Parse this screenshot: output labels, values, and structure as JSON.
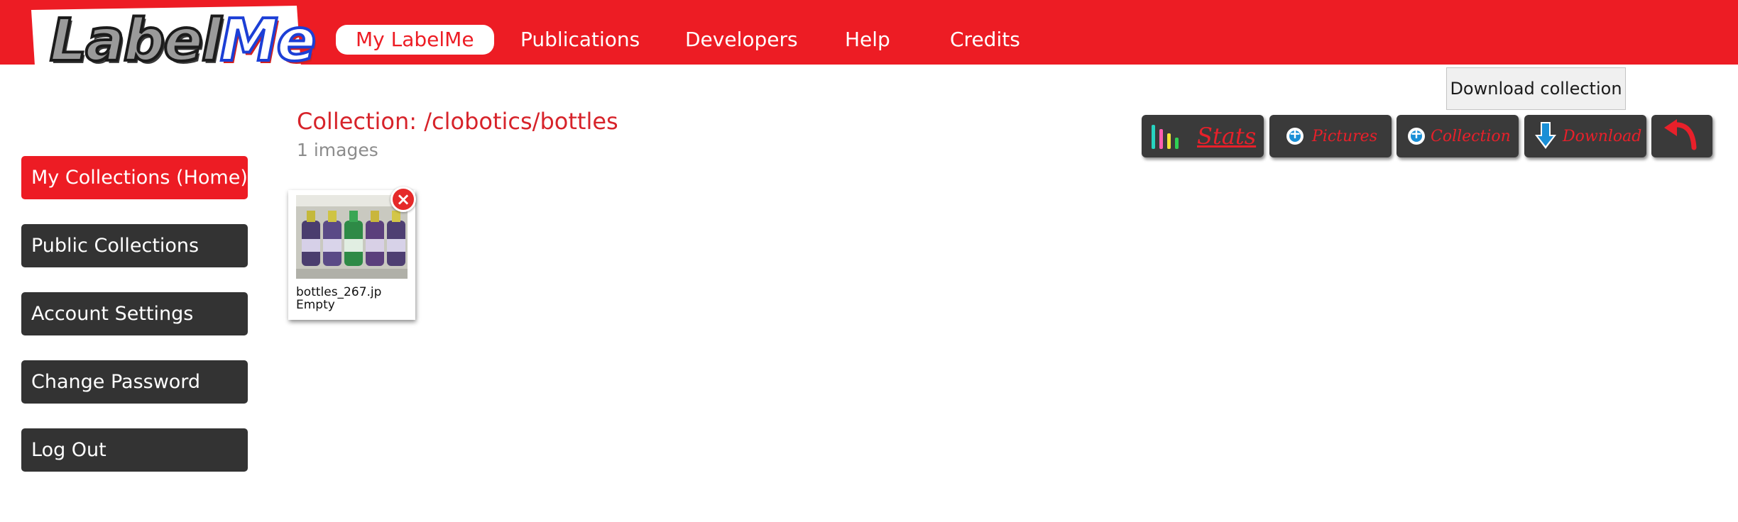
{
  "header": {
    "logo_text": "LabelMe",
    "nav": [
      "My LabelMe",
      "Publications",
      "Developers",
      "Help",
      "Credits"
    ]
  },
  "tooltip": "Download collection",
  "sidebar": {
    "items": [
      "My Collections (Home)",
      "Public Collections",
      "Account Settings",
      "Change Password",
      "Log Out"
    ]
  },
  "collection": {
    "title": "Collection: /clobotics/bottles",
    "count": "1 images"
  },
  "toolbar": {
    "stats": "Stats",
    "pictures": "Pictures",
    "collection": "Collection",
    "download": "Download"
  },
  "images": [
    {
      "name": "bottles_267.jp",
      "status": "Empty"
    }
  ],
  "colors": {
    "brand_red": "#ed1c24",
    "dark_button": "#333333",
    "icon_blue": "#1a8fd6"
  },
  "icons": [
    "stats-icon",
    "plus-circle-icon",
    "download-arrow-icon",
    "back-arrow-icon",
    "delete-icon"
  ]
}
